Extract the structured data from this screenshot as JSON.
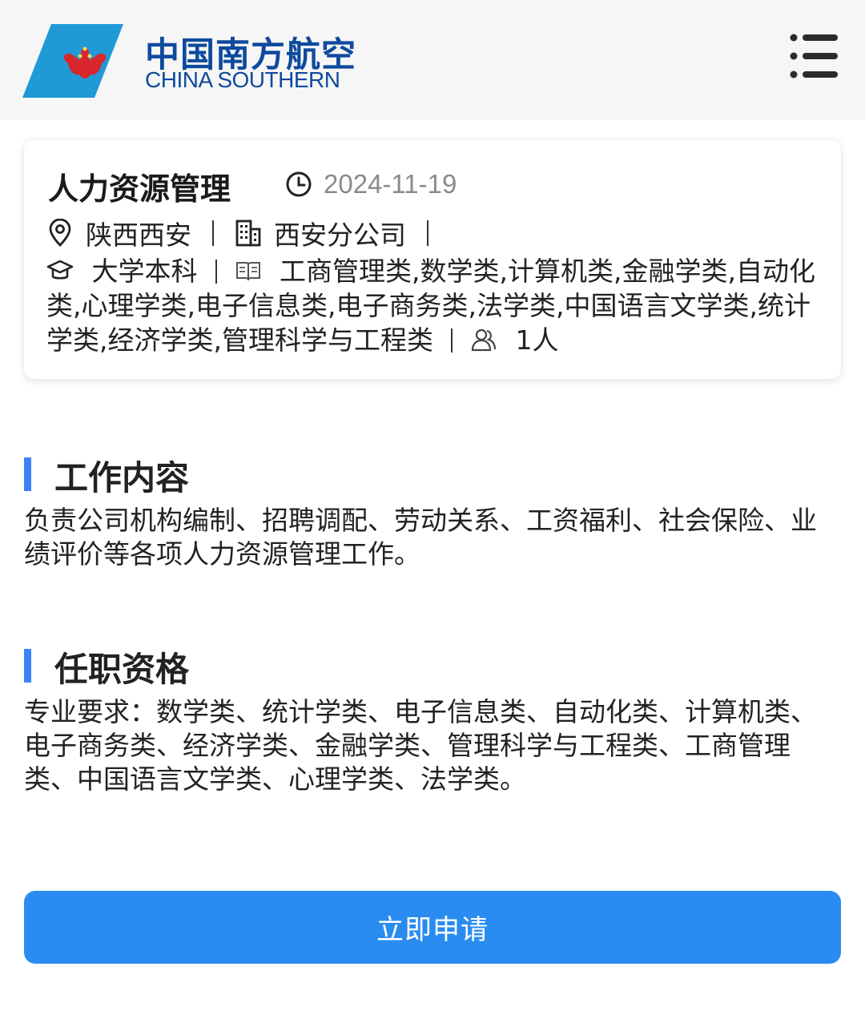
{
  "header": {
    "logo_cn": "中国南方航空",
    "logo_en": "CHINA SOUTHERN",
    "menu_icon": "menu-list-icon"
  },
  "job": {
    "title": "人力资源管理",
    "date": "2024-11-19",
    "location": "陕西西安",
    "company": "西安分公司",
    "education": "大学本科",
    "majors": "工商管理类,数学类,计算机类,金融学类,自动化类,心理学类,电子信息类,电子商务类,法学类,中国语言文学类,统计学类,经济学类,管理科学与工程类",
    "headcount": "1人"
  },
  "sections": {
    "content_title": "工作内容",
    "content_body": "负责公司机构编制、招聘调配、劳动关系、工资福利、社会保险、业绩评价等各项人力资源管理工作。",
    "qual_title": "任职资格",
    "qual_body": "专业要求：数学类、统计学类、电子信息类、自动化类、计算机类、电子商务类、经济学类、金融学类、管理科学与工程类、工商管理类、中国语言文学类、心理学类、法学类。"
  },
  "apply_label": "立即申请",
  "colors": {
    "brand_blue": "#0e4a9e",
    "logo_sky": "#1f9ad6",
    "accent": "#3b82f6",
    "button": "#2a8cf0",
    "logo_red": "#d8262e"
  }
}
